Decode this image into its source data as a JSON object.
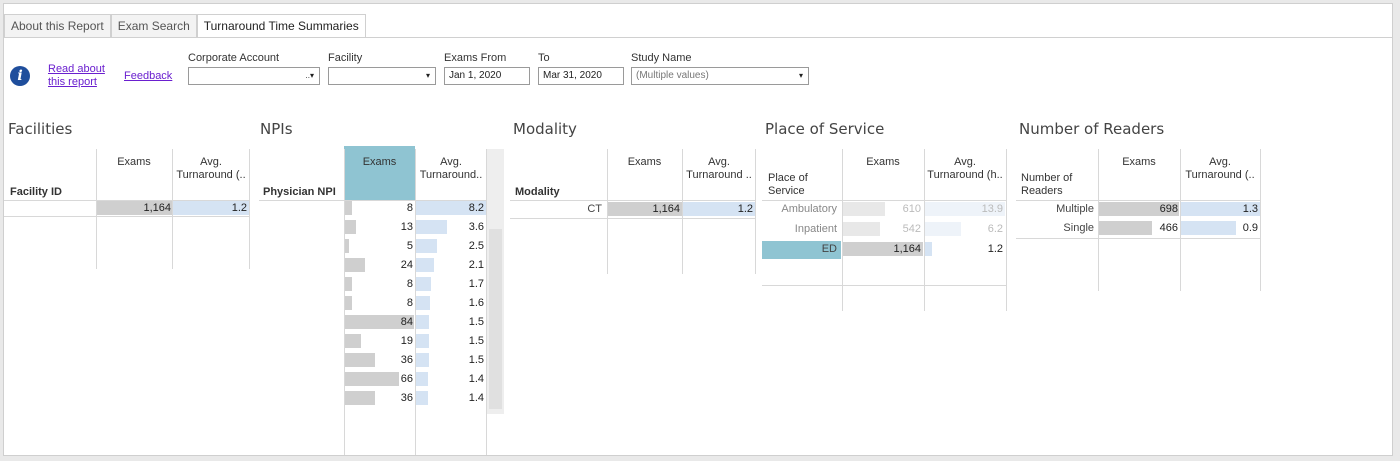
{
  "tabs": [
    "About this Report",
    "Exam Search",
    "Turnaround Time Summaries"
  ],
  "links": {
    "read_about_1": "Read about",
    "read_about_2": "this report",
    "feedback": "Feedback"
  },
  "filters": {
    "corporate_account": {
      "label": "Corporate Account",
      "value": "",
      "arrow": "..▾"
    },
    "facility": {
      "label": "Facility",
      "value": "",
      "arrow": "▾"
    },
    "exams_from": {
      "label": "Exams From",
      "value": "Jan 1, 2020"
    },
    "to": {
      "label": "To",
      "value": "Mar 31, 2020"
    },
    "study_name": {
      "label": "Study Name",
      "value": "(Multiple values)",
      "arrow": "▾"
    }
  },
  "facilities": {
    "title": "Facilities",
    "row_header": "Facility ID",
    "exams_header": "Exams",
    "avg_header_1": "Avg.",
    "avg_header_2": "Turnaround (..",
    "rows": [
      {
        "exams": "1,164",
        "avg": "1.2",
        "exams_frac": 1.0,
        "avg_frac": 1.0
      }
    ]
  },
  "npis": {
    "title": "NPIs",
    "row_header": "Physician NPI",
    "exams_header": "Exams",
    "avg_header_1": "Avg.",
    "avg_header_2": "Turnaround..",
    "rows": [
      {
        "exams": "8",
        "avg": "8.2",
        "exams_num": 8,
        "avg_num": 8.2
      },
      {
        "exams": "13",
        "avg": "3.6",
        "exams_num": 13,
        "avg_num": 3.6
      },
      {
        "exams": "5",
        "avg": "2.5",
        "exams_num": 5,
        "avg_num": 2.5
      },
      {
        "exams": "24",
        "avg": "2.1",
        "exams_num": 24,
        "avg_num": 2.1
      },
      {
        "exams": "8",
        "avg": "1.7",
        "exams_num": 8,
        "avg_num": 1.7
      },
      {
        "exams": "8",
        "avg": "1.6",
        "exams_num": 8,
        "avg_num": 1.6
      },
      {
        "exams": "84",
        "avg": "1.5",
        "exams_num": 84,
        "avg_num": 1.5
      },
      {
        "exams": "19",
        "avg": "1.5",
        "exams_num": 19,
        "avg_num": 1.5
      },
      {
        "exams": "36",
        "avg": "1.5",
        "exams_num": 36,
        "avg_num": 1.5
      },
      {
        "exams": "66",
        "avg": "1.4",
        "exams_num": 66,
        "avg_num": 1.4
      },
      {
        "exams": "36",
        "avg": "1.4",
        "exams_num": 36,
        "avg_num": 1.4
      }
    ]
  },
  "modality": {
    "title": "Modality",
    "row_header": "Modality",
    "exams_header": "Exams",
    "avg_header_1": "Avg.",
    "avg_header_2": "Turnaround ..",
    "rows": [
      {
        "category": "CT",
        "exams": "1,164",
        "avg": "1.2"
      }
    ]
  },
  "place_of_service": {
    "title": "Place of Service",
    "row_header_1": "Place of",
    "row_header_2": "Service",
    "exams_header": "Exams",
    "avg_header_1": "Avg.",
    "avg_header_2": "Turnaround (h..",
    "rows": [
      {
        "category": "Ambulatory",
        "exams": "610",
        "avg": "13.9",
        "exams_num": 610,
        "avg_num": 13.9,
        "selected": false
      },
      {
        "category": "Inpatient",
        "exams": "542",
        "avg": "6.2",
        "exams_num": 542,
        "avg_num": 6.2,
        "selected": false
      },
      {
        "category": "ED",
        "exams": "1,164",
        "avg": "1.2",
        "exams_num": 1164,
        "avg_num": 1.2,
        "selected": true
      }
    ]
  },
  "readers": {
    "title": "Number of Readers",
    "row_header_1": "Number of",
    "row_header_2": "Readers",
    "exams_header": "Exams",
    "avg_header_1": "Avg.",
    "avg_header_2": "Turnaround (..",
    "rows": [
      {
        "category": "Multiple",
        "exams": "698",
        "avg": "1.3",
        "exams_num": 698,
        "avg_num": 1.3
      },
      {
        "category": "Single",
        "exams": "466",
        "avg": "0.9",
        "exams_num": 466,
        "avg_num": 0.9
      }
    ]
  },
  "colors": {
    "highlight": "#8fc4d2",
    "link": "#6a1fcf",
    "info_icon": "#1f4e9c",
    "exams_bar": "#cfcfcf",
    "avg_bar": "#d5e3f3"
  }
}
